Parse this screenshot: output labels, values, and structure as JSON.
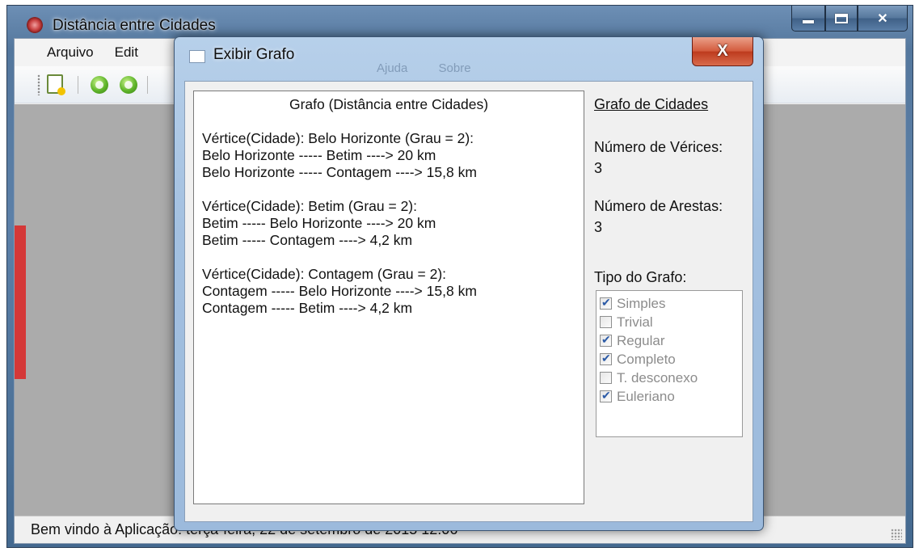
{
  "main_window": {
    "title": "Distância entre Cidades",
    "menu": [
      "Arquivo",
      "Edit"
    ],
    "status_text": "Bem vindo à Aplicação! terça-feira, 22 de setembro de 2015 12:06"
  },
  "dialog": {
    "title": "Exibir Grafo",
    "close_label": "X",
    "ghost_tabs": [
      "Ajuda",
      "Sobre"
    ],
    "text_heading": "Grafo (Distância entre Cidades)",
    "vertices": [
      {
        "header": "Vértice(Cidade): Belo Horizonte (Grau = 2):",
        "edges": [
          "Belo Horizonte ----- Betim ----> 20 km",
          "Belo Horizonte ----- Contagem ----> 15,8 km"
        ]
      },
      {
        "header": "Vértice(Cidade): Betim (Grau = 2):",
        "edges": [
          "Betim ----- Belo Horizonte ----> 20 km",
          "Betim ----- Contagem ----> 4,2 km"
        ]
      },
      {
        "header": "Vértice(Cidade): Contagem (Grau = 2):",
        "edges": [
          "Contagem ----- Belo Horizonte ----> 15,8 km",
          "Contagem ----- Betim ----> 4,2 km"
        ]
      }
    ],
    "side": {
      "title": "Grafo de Cidades",
      "vertices_label": "Número de Vérices:",
      "vertices_value": "3",
      "edges_label": "Número de Arestas:",
      "edges_value": "3",
      "type_label": "Tipo do Grafo:",
      "types": [
        {
          "label": "Simples",
          "checked": true
        },
        {
          "label": "Trivial",
          "checked": false
        },
        {
          "label": "Regular",
          "checked": true
        },
        {
          "label": "Completo",
          "checked": true
        },
        {
          "label": "T. desconexo",
          "checked": false
        },
        {
          "label": "Euleriano",
          "checked": true
        }
      ]
    }
  },
  "icons": [
    "app-icon",
    "minimize-icon",
    "maximize-icon",
    "close-icon",
    "new-file-icon",
    "green-circle-icon",
    "window-icon",
    "resize-grip-icon"
  ],
  "colors": {
    "title_bar": "#5a7fa6",
    "dialog_frame": "#a3c0e0",
    "close_button": "#d35a3c",
    "check_mark": "#2b5aa6",
    "accent_bar": "#d43838"
  }
}
